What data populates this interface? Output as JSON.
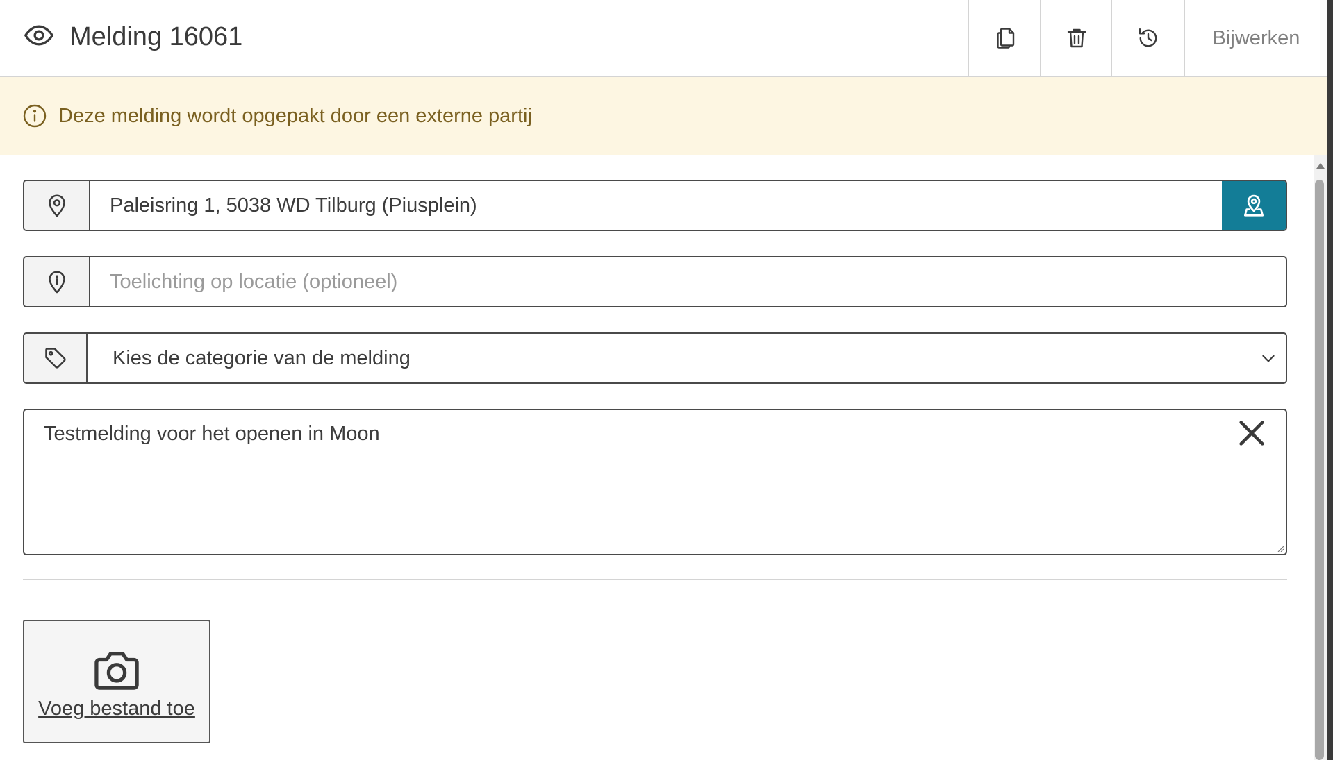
{
  "header": {
    "title": "Melding 16061",
    "update_label": "Bijwerken"
  },
  "banner": {
    "text": "Deze melding wordt opgepakt door een externe partij"
  },
  "form": {
    "address_value": "Paleisring 1, 5038 WD Tilburg (Piusplein)",
    "location_note_placeholder": "Toelichting op locatie (optioneel)",
    "category_selected": "Kies de categorie van de melding",
    "description_value": "Testmelding voor het openen in Moon"
  },
  "upload": {
    "label": "Voeg bestand toe"
  },
  "colors": {
    "accent": "#137d97",
    "banner_bg": "#fdf6e2",
    "banner_text": "#7a6020"
  }
}
